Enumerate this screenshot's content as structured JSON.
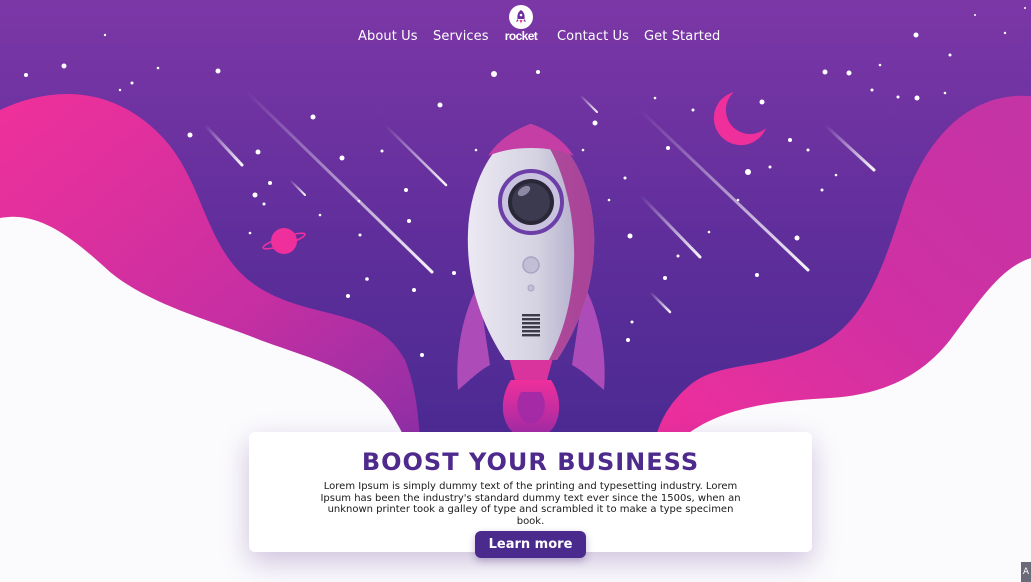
{
  "nav": {
    "links": [
      {
        "label": "About Us"
      },
      {
        "label": "Services"
      },
      {
        "label": "Contact Us"
      },
      {
        "label": "Get Started"
      }
    ],
    "logo_text": "rocket"
  },
  "hero": {
    "title": "BOOST YOUR BUSINESS",
    "body": "Lorem Ipsum is simply dummy text of the printing and typesetting industry. Lorem Ipsum has been the industry's standard dummy text ever since the 1500s, when an unknown printer took a galley of type and scrambled it to make a type specimen book.",
    "cta_label": "Learn more"
  },
  "colors": {
    "sky_top": "#7a35a5",
    "sky_bottom": "#4d2a93",
    "wave_pink": "#ef2f9b",
    "accent_purple": "#4b2a8e"
  },
  "icons": {
    "logo": "rocket-icon",
    "moon": "moon-icon",
    "planet": "planet-icon"
  },
  "corner": {
    "label": "A"
  }
}
